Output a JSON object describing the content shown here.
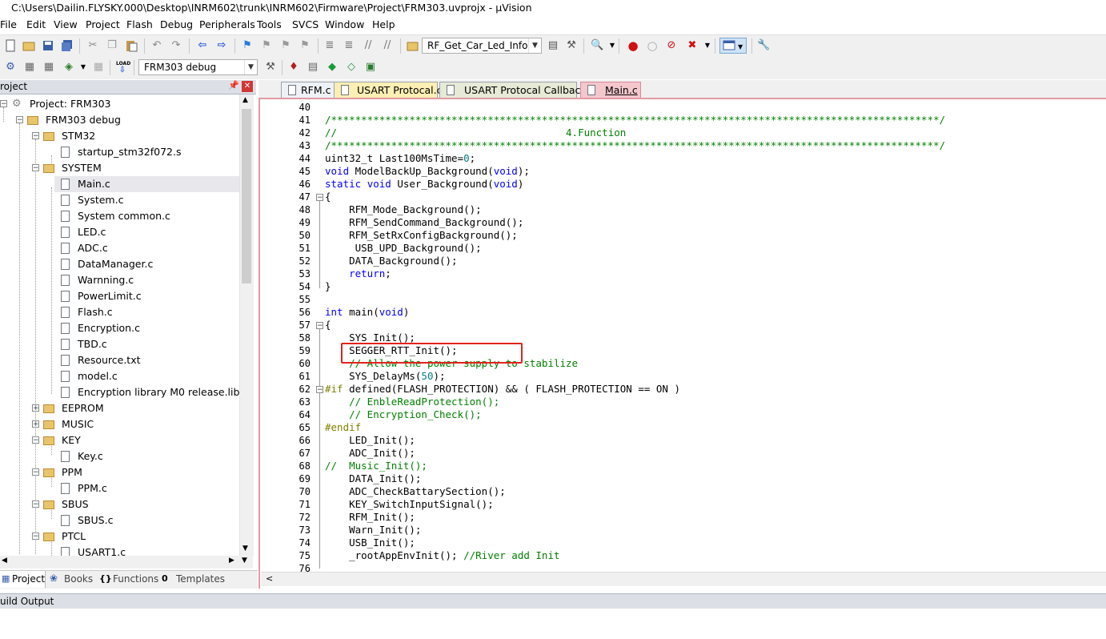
{
  "window": {
    "title": "C:\\Users\\Dailin.FLYSKY.000\\Desktop\\INRM602\\trunk\\INRM602\\Firmware\\Project\\FRM303.uvprojx - µVision"
  },
  "menu": [
    "File",
    "Edit",
    "View",
    "Project",
    "Flash",
    "Debug",
    "Peripherals",
    "Tools",
    "SVCS",
    "Window",
    "Help"
  ],
  "toolbar": {
    "find_combo": "RF_Get_Car_Led_Info",
    "target_combo": "FRM303 debug",
    "load_label": "LOAD"
  },
  "project_pane": {
    "header": "roject",
    "pin_icon": "pin-icon",
    "tree": [
      {
        "label": "Project: FRM303",
        "kind": "root"
      },
      {
        "label": "FRM303 debug",
        "kind": "target"
      },
      {
        "label": "STM32",
        "kind": "folder"
      },
      {
        "label": "startup_stm32f072.s",
        "kind": "file"
      },
      {
        "label": "SYSTEM",
        "kind": "folder"
      },
      {
        "label": "Main.c",
        "kind": "file",
        "selected": true
      },
      {
        "label": "System.c",
        "kind": "file"
      },
      {
        "label": "System common.c",
        "kind": "file"
      },
      {
        "label": "LED.c",
        "kind": "file"
      },
      {
        "label": "ADC.c",
        "kind": "file"
      },
      {
        "label": "DataManager.c",
        "kind": "file"
      },
      {
        "label": "Warnning.c",
        "kind": "file"
      },
      {
        "label": "PowerLimit.c",
        "kind": "file"
      },
      {
        "label": "Flash.c",
        "kind": "file"
      },
      {
        "label": "Encryption.c",
        "kind": "file"
      },
      {
        "label": "TBD.c",
        "kind": "file"
      },
      {
        "label": "Resource.txt",
        "kind": "file"
      },
      {
        "label": "model.c",
        "kind": "file"
      },
      {
        "label": "Encryption library M0 release.lib",
        "kind": "file"
      },
      {
        "label": "EEPROM",
        "kind": "folder"
      },
      {
        "label": "MUSIC",
        "kind": "folder"
      },
      {
        "label": "KEY",
        "kind": "folder"
      },
      {
        "label": "Key.c",
        "kind": "file"
      },
      {
        "label": "PPM",
        "kind": "folder"
      },
      {
        "label": "PPM.c",
        "kind": "file"
      },
      {
        "label": "SBUS",
        "kind": "folder"
      },
      {
        "label": "SBUS.c",
        "kind": "file"
      },
      {
        "label": "PTCL",
        "kind": "folder"
      },
      {
        "label": "USART1.c",
        "kind": "file"
      }
    ],
    "tabs": [
      "Project",
      "Books",
      "Functions",
      "Templates"
    ]
  },
  "editor": {
    "tabs": [
      "RFM.c",
      "USART Protocal.c",
      "USART Protocal Callback.c",
      "Main.c"
    ],
    "active_tab": "Main.c",
    "lines": [
      {
        "n": "40",
        "t": ""
      },
      {
        "n": "41",
        "t": "/*****************************************************************************************************/"
      },
      {
        "n": "42",
        "t": "//                                      4.Function"
      },
      {
        "n": "43",
        "t": "/*****************************************************************************************************/"
      },
      {
        "n": "44",
        "t": "uint32_t Last100MsTime=0;"
      },
      {
        "n": "45",
        "t": "void ModelBackUp_Background(void);"
      },
      {
        "n": "46",
        "t": "static void User_Background(void)"
      },
      {
        "n": "47",
        "t": "{"
      },
      {
        "n": "48",
        "t": "    RFM_Mode_Background();"
      },
      {
        "n": "49",
        "t": "    RFM_SendCommand_Background();"
      },
      {
        "n": "50",
        "t": "    RFM_SetRxConfigBackground();"
      },
      {
        "n": "51",
        "t": "     USB_UPD_Background();"
      },
      {
        "n": "52",
        "t": "    DATA_Background();"
      },
      {
        "n": "53",
        "t": "    return;"
      },
      {
        "n": "54",
        "t": "}"
      },
      {
        "n": "55",
        "t": ""
      },
      {
        "n": "56",
        "t": "int main(void)"
      },
      {
        "n": "57",
        "t": "{"
      },
      {
        "n": "58",
        "t": "    SYS_Init();"
      },
      {
        "n": "59",
        "t": "    SEGGER_RTT_Init();"
      },
      {
        "n": "60",
        "t": "    // Allow the power supply to stabilize"
      },
      {
        "n": "61",
        "t": "    SYS_DelayMs(50);"
      },
      {
        "n": "62",
        "t": "#if defined(FLASH_PROTECTION) && ( FLASH_PROTECTION == ON )"
      },
      {
        "n": "63",
        "t": "    // EnbleReadProtection();"
      },
      {
        "n": "64",
        "t": "    // Encryption_Check();"
      },
      {
        "n": "65",
        "t": "#endif"
      },
      {
        "n": "66",
        "t": "    LED_Init();"
      },
      {
        "n": "67",
        "t": "    ADC_Init();"
      },
      {
        "n": "68",
        "t": "//  Music_Init();"
      },
      {
        "n": "69",
        "t": "    DATA_Init();"
      },
      {
        "n": "70",
        "t": "    ADC_CheckBattarySection();"
      },
      {
        "n": "71",
        "t": "    KEY_SwitchInputSignal();"
      },
      {
        "n": "72",
        "t": "    RFM_Init();"
      },
      {
        "n": "73",
        "t": "    Warn_Init();"
      },
      {
        "n": "74",
        "t": "    USB_Init();"
      },
      {
        "n": "75",
        "t": "    _rootAppEnvInit(); //River add Init"
      },
      {
        "n": "76",
        "t": ""
      }
    ]
  },
  "build_output": {
    "title": "uild Output"
  },
  "colors": {
    "keyword": "#0000ff",
    "comment": "#008000",
    "number": "#008080",
    "preproc": "#808000",
    "highlight_box": "#e0241c",
    "active_tab": "#f4c7cd"
  }
}
